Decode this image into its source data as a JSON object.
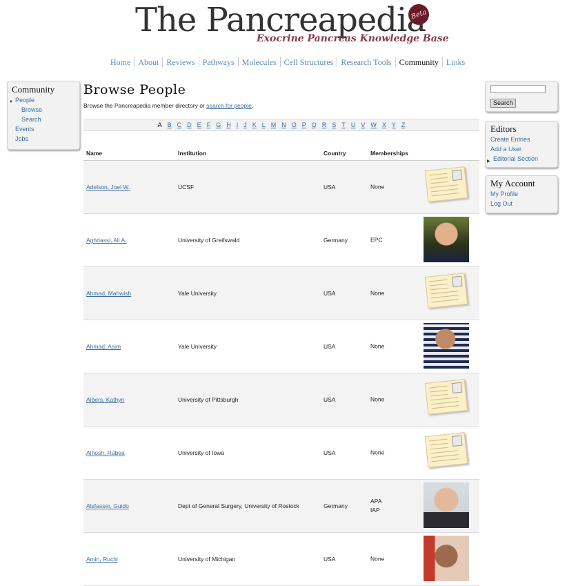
{
  "header": {
    "logo_the": "The",
    "logo_name": "Pancreapedia",
    "beta": "Beta",
    "tagline": "Exocrine Pancreas Knowledge Base"
  },
  "topnav": [
    "Home",
    "About",
    "Reviews",
    "Pathways",
    "Molecules",
    "Cell Structures",
    "Research Tools",
    "Community",
    "Links"
  ],
  "topnav_active": "Community",
  "left_nav": {
    "title": "Community",
    "people": "People",
    "browse": "Browse",
    "search": "Search",
    "events": "Events",
    "jobs": "Jobs"
  },
  "main": {
    "title": "Browse People",
    "intro_prefix": "Browse the Pancreapedia member directory or ",
    "intro_link": "search for people",
    "intro_suffix": ".",
    "alphabet": [
      "A",
      "B",
      "C",
      "D",
      "E",
      "F",
      "G",
      "H",
      "I",
      "J",
      "K",
      "L",
      "M",
      "N",
      "O",
      "P",
      "Q",
      "R",
      "S",
      "T",
      "U",
      "V",
      "W",
      "X",
      "Y",
      "Z"
    ],
    "columns": {
      "name": "Name",
      "institution": "Institution",
      "country": "Country",
      "memberships": "Memberships"
    },
    "rows": [
      {
        "name": "Adelson, Joel W.",
        "institution": "UCSF",
        "country": "USA",
        "memberships": "None",
        "picture": "card"
      },
      {
        "name": "Aghdassi, Ali A.",
        "institution": "University of Greifswald",
        "country": "Germany",
        "memberships": "EPC",
        "picture": "photo-1"
      },
      {
        "name": "Ahmad, Mahwish",
        "institution": "Yale University",
        "country": "USA",
        "memberships": "None",
        "picture": "card"
      },
      {
        "name": "Ahmad, Asim",
        "institution": "Yale University",
        "country": "USA",
        "memberships": "None",
        "picture": "photo-2"
      },
      {
        "name": "Albers, Kathyn",
        "institution": "University of Pittsburgh",
        "country": "USA",
        "memberships": "None",
        "picture": "card"
      },
      {
        "name": "Alhosh, Rabea",
        "institution": "University of Iowa",
        "country": "USA",
        "memberships": "None",
        "picture": "card"
      },
      {
        "name": "Alsfasser, Guido",
        "institution": "Dept of General Surgery, University of Rostock",
        "country": "Germany",
        "memberships": "APA\nIAP",
        "picture": "photo-3"
      },
      {
        "name": "Amin, Ruchi",
        "institution": "University of Michigan",
        "country": "USA",
        "memberships": "None",
        "picture": "photo-4"
      }
    ]
  },
  "sidebar_right": {
    "search_button": "Search",
    "editors_title": "Editors",
    "create_entries": "Create Entries",
    "add_user": "Add a User",
    "editorial_section": "Editorial Section",
    "account_title": "My Account",
    "my_profile": "My Profile",
    "log_out": "Log Out"
  }
}
